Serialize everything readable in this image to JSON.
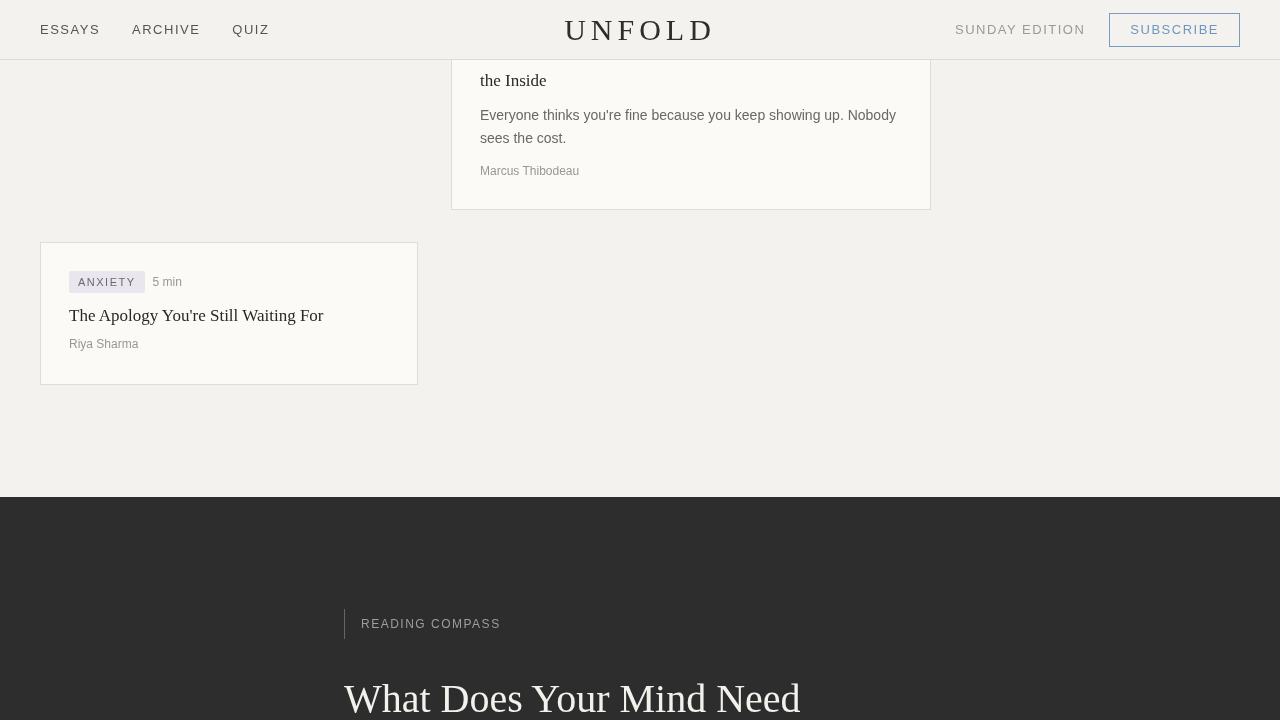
{
  "header": {
    "nav": [
      "ESSAYS",
      "ARCHIVE",
      "QUIZ"
    ],
    "logo": "UNFOLD",
    "edition": "SUNDAY EDITION",
    "subscribe": "SUBSCRIBE"
  },
  "articles": [
    {
      "title": "the Inside",
      "excerpt": "Everyone thinks you're fine because you keep showing up. Nobody sees the cost.",
      "author": "Marcus Thibodeau"
    },
    {
      "tag": "ANXIETY",
      "read_time": "5 min",
      "title": "The Apology You're Still Waiting For",
      "author": "Riya Sharma"
    }
  ],
  "compass": {
    "label": "READING COMPASS",
    "heading": "What Does Your Mind Need"
  }
}
